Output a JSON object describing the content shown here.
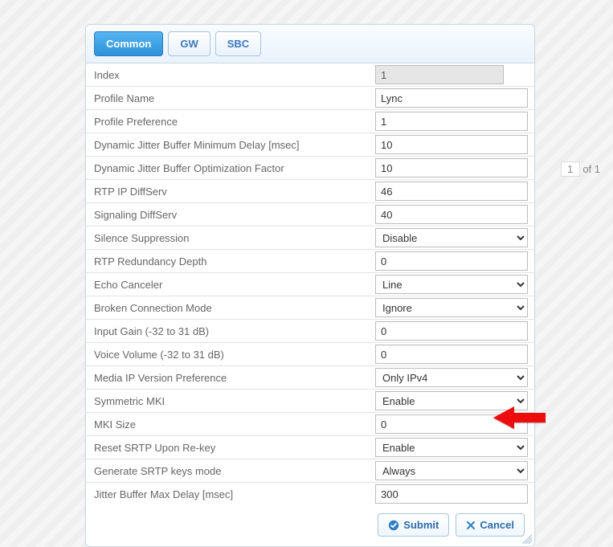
{
  "pager": {
    "page": "1",
    "of": "of 1"
  },
  "tabs": [
    "Common",
    "GW",
    "SBC"
  ],
  "fields": {
    "index": {
      "label": "Index",
      "value": "1"
    },
    "profile_name": {
      "label": "Profile Name",
      "value": "Lync"
    },
    "profile_pref": {
      "label": "Profile Preference",
      "value": "1"
    },
    "dj_min_delay": {
      "label": "Dynamic Jitter Buffer Minimum Delay [msec]",
      "value": "10"
    },
    "dj_opt_factor": {
      "label": "Dynamic Jitter Buffer Optimization Factor",
      "value": "10"
    },
    "rtp_diffserv": {
      "label": "RTP IP DiffServ",
      "value": "46"
    },
    "sig_diffserv": {
      "label": "Signaling DiffServ",
      "value": "40"
    },
    "silence_supp": {
      "label": "Silence Suppression",
      "value": "Disable"
    },
    "rtp_redundancy": {
      "label": "RTP Redundancy Depth",
      "value": "0"
    },
    "echo_cancel": {
      "label": "Echo Canceler",
      "value": "Line"
    },
    "broken_conn": {
      "label": "Broken Connection Mode",
      "value": "Ignore"
    },
    "input_gain": {
      "label": "Input Gain (-32 to 31 dB)",
      "value": "0"
    },
    "voice_volume": {
      "label": "Voice Volume (-32 to 31 dB)",
      "value": "0"
    },
    "ip_ver_pref": {
      "label": "Media IP Version Preference",
      "value": "Only IPv4"
    },
    "sym_mki": {
      "label": "Symmetric MKI",
      "value": "Enable"
    },
    "mki_size": {
      "label": "MKI Size",
      "value": "0"
    },
    "reset_srtp": {
      "label": "Reset SRTP Upon Re-key",
      "value": "Enable"
    },
    "gen_srtp": {
      "label": "Generate SRTP keys mode",
      "value": "Always"
    },
    "jb_max_delay": {
      "label": "Jitter Buffer Max Delay [msec]",
      "value": "300"
    }
  },
  "buttons": {
    "submit": "Submit",
    "cancel": "Cancel"
  }
}
